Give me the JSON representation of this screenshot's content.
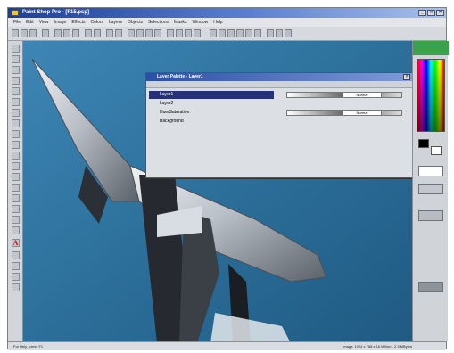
{
  "app": {
    "title": "Paint Shop Pro - [F15.psp]",
    "window_buttons": [
      "_",
      "□",
      "×"
    ]
  },
  "menubar": [
    "File",
    "Edit",
    "View",
    "Image",
    "Effects",
    "Colors",
    "Layers",
    "Objects",
    "Selections",
    "Masks",
    "Window",
    "Help"
  ],
  "layers_palette": {
    "title": "Layer Palette - Layer1",
    "rows": [
      {
        "label": "Layer1",
        "selected": true
      },
      {
        "label": "Layer2",
        "selected": false
      },
      {
        "label": "Hue/Saturation",
        "selected": false
      },
      {
        "label": "Background",
        "selected": false
      }
    ],
    "mode": "Normal"
  },
  "statusbar": {
    "left": "For Help, press F1",
    "right": "Image: 1024 x 768 x 16 Million - 2.3 MBytes"
  },
  "colors": {
    "sky": "#2c6f9a",
    "title_active": "#1c3f9a",
    "layer_selected": "#27317a"
  }
}
